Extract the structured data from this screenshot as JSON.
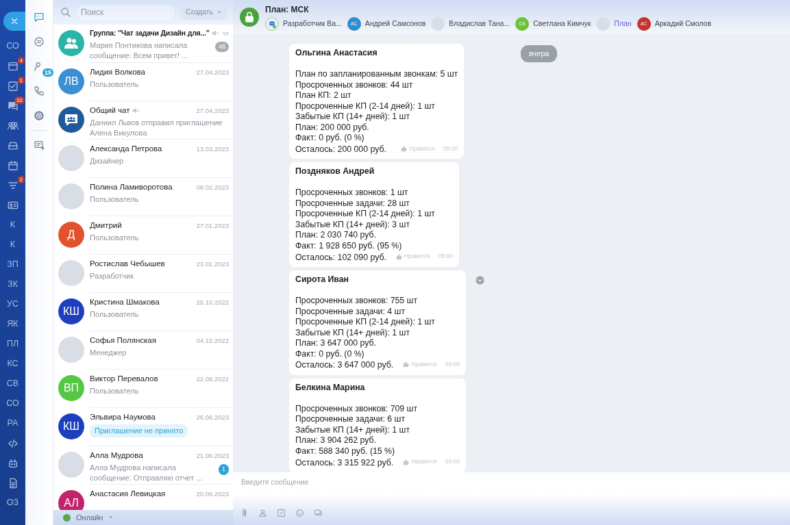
{
  "nav_strip": {
    "items": [
      {
        "kind": "text",
        "label": "СО"
      },
      {
        "kind": "icon",
        "badge": "4"
      },
      {
        "kind": "icon",
        "badge": "1"
      },
      {
        "kind": "icon",
        "badge": "32"
      },
      {
        "kind": "icon"
      },
      {
        "kind": "icon"
      },
      {
        "kind": "icon"
      },
      {
        "kind": "icon",
        "badge": "2"
      },
      {
        "kind": "icon"
      },
      {
        "kind": "text",
        "label": "К"
      },
      {
        "kind": "text",
        "label": "К"
      },
      {
        "kind": "text",
        "label": "ЗП"
      },
      {
        "kind": "text",
        "label": "ЗК"
      },
      {
        "kind": "text",
        "label": "УС"
      },
      {
        "kind": "text",
        "label": "ЯК"
      },
      {
        "kind": "text",
        "label": "ПЛ"
      },
      {
        "kind": "text",
        "label": "КС"
      },
      {
        "kind": "text",
        "label": "СВ"
      },
      {
        "kind": "text",
        "label": "СО"
      },
      {
        "kind": "text",
        "label": "РА"
      },
      {
        "kind": "icon"
      },
      {
        "kind": "icon"
      },
      {
        "kind": "icon"
      },
      {
        "kind": "text",
        "label": "ОЗ"
      }
    ]
  },
  "tools": [
    {
      "selected": true
    },
    {
      "selected": false
    },
    {
      "selected": false,
      "badge": "15"
    },
    {
      "selected": false
    },
    {
      "selected": false
    },
    {
      "selected": false
    }
  ],
  "search": {
    "placeholder": "Поиск"
  },
  "create_button": {
    "label": "Создать"
  },
  "chats": [
    {
      "kind": "group",
      "color": "#2bb5a6",
      "name": "Группа: \"Чат задачи Дизайн для...\"",
      "date": "чт",
      "muted": true,
      "unread": "46",
      "subtitle": "Мария Понтикова написала сообщение: Всем привет! ..."
    },
    {
      "kind": "initials",
      "initials": "ЛВ",
      "color": "#3d8fd4",
      "name": "Лидия Волкова",
      "date": "27.04.2023",
      "muted": false,
      "subtitle": "Пользователь"
    },
    {
      "kind": "chat",
      "color": "#215a9a",
      "name": "Общий чат",
      "date": "27.04.2023",
      "muted": true,
      "subtitle": "Даниил Львов отправил приглашение Алена Викулова"
    },
    {
      "kind": "photo",
      "name": "Александа Петрова",
      "date": "13.03.2023",
      "muted": false,
      "subtitle": "Дизайнер"
    },
    {
      "kind": "photo",
      "name": "Полина Ламиворотова",
      "date": "08.02.2023",
      "muted": false,
      "subtitle": "Пользователь"
    },
    {
      "kind": "initials",
      "initials": "Д",
      "color": "#e2532d",
      "name": "Дмитрий",
      "date": "27.01.2023",
      "muted": false,
      "subtitle": "Пользователь"
    },
    {
      "kind": "photo",
      "name": "Ростислав Чебышев",
      "date": "23.01.2023",
      "muted": false,
      "subtitle": "Разработчик"
    },
    {
      "kind": "initials",
      "initials": "КШ",
      "color": "#1d3fbf",
      "name": "Кристина Шмакова",
      "date": "26.10.2022",
      "muted": false,
      "subtitle": "Пользователь"
    },
    {
      "kind": "photo",
      "name": "Софья Полянская",
      "date": "04.10.2022",
      "muted": false,
      "subtitle": "Менеджер"
    },
    {
      "kind": "initials",
      "initials": "ВП",
      "color": "#55c745",
      "name": "Виктор Перевалов",
      "date": "22.08.2022",
      "muted": false,
      "subtitle": "Пользователь"
    },
    {
      "kind": "initials",
      "initials": "КШ",
      "color": "#1d3fbf",
      "name": "Эльвира Наумова",
      "date": "26.06.2023",
      "muted": false,
      "invite": "Приглашение не принято"
    },
    {
      "kind": "photo",
      "name": "Алла Мудрова",
      "date": "21.06.2023",
      "muted": false,
      "unread": "1",
      "subtitle": "Алла Мудрова написала сообщение: Отправляю отчет ..."
    },
    {
      "kind": "initials",
      "initials": "АЛ",
      "color": "#c2246b",
      "name": "Анастасия Левицкая",
      "date": "20.06.2023",
      "muted": false
    }
  ],
  "status": {
    "label": "Онлайн"
  },
  "header": {
    "title": "План: МСК",
    "members": [
      {
        "kind": "bot",
        "name": "Разработчик Ва...",
        "link": false
      },
      {
        "kind": "initials",
        "initials": "АС",
        "color": "#2e8fcf",
        "name": "Андрей Самсонов",
        "link": false
      },
      {
        "kind": "photo",
        "name": "Владислав Тана...",
        "link": false
      },
      {
        "kind": "initials",
        "initials": "СК",
        "color": "#6cc23c",
        "name": "Светлана Кимчук",
        "link": false
      },
      {
        "kind": "photo",
        "name": "План",
        "link": true
      },
      {
        "kind": "initials",
        "initials": "АС",
        "color": "#c8302e",
        "name": "Аркадий Смолов",
        "link": false
      }
    ]
  },
  "date_divider": "вчера",
  "messages": [
    {
      "author": "Ольгина Анастасия",
      "lines": [
        "План по запланированным звонкам: 5 шт",
        "Просроченных звонков: 44 шт",
        "План КП: 2 шт",
        "Просроченные КП (2-14 дней): 1 шт",
        "Забытые КП (14+ дней): 1 шт",
        "План: 200 000 руб.",
        "Факт: 0 руб. (0 %)",
        "Осталось: 200 000 руб."
      ],
      "like": "Нравится",
      "time": "09:00",
      "menu_shown": false
    },
    {
      "author": "Поздняков Андрей",
      "lines": [
        "Просроченных звонков: 1 шт",
        "Просроченные задачи: 28 шт",
        "Просроченные КП (2-14 дней): 1 шт",
        "Забытые КП (14+ дней): 3 шт",
        "План: 2 030 740 руб.",
        "Факт: 1 928 650 руб. (95 %)",
        "Осталось: 102 090 руб."
      ],
      "like": "Нравится",
      "time": "09:00",
      "menu_shown": false
    },
    {
      "author": "Сирота Иван",
      "lines": [
        "Просроченных звонков: 755 шт",
        "Просроченные задачи: 4 шт",
        "Просроченные КП (2-14 дней): 1 шт",
        "Забытые КП (14+ дней): 1 шт",
        "План: 3 647 000 руб.",
        "Факт: 0 руб. (0 %)",
        "Осталось: 3 647 000 руб."
      ],
      "like": "Нравится",
      "time": "09:00",
      "menu_shown": true
    },
    {
      "author": "Белкина Марина",
      "lines": [
        "Просроченных звонков: 709 шт",
        "Просроченные задачи: 6 шт",
        "Забытые КП (14+ дней): 1 шт",
        "План: 3 904 262 руб.",
        "Факт: 588 340 руб. (15 %)",
        "Осталось: 3 315 922 руб."
      ],
      "like": "Нравится",
      "time": "09:00",
      "menu_shown": false
    }
  ],
  "composer": {
    "placeholder": "Введите сообщение"
  }
}
